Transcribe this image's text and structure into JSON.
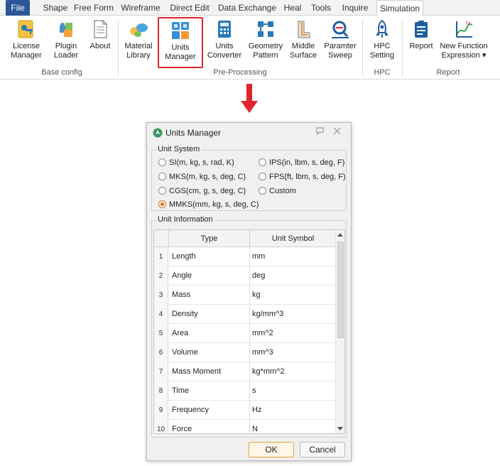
{
  "ribbon": {
    "tabs": [
      "File",
      "Shape",
      "Free Form",
      "Wireframe",
      "Direct Edit",
      "Data Exchange",
      "Heal",
      "Tools",
      "Inquire",
      "Simulation"
    ],
    "active_tab": "Simulation",
    "buttons": {
      "license_manager": [
        "License",
        "Manager"
      ],
      "plugin_loader": [
        "Plugin",
        "Loader"
      ],
      "about": [
        "About",
        ""
      ],
      "material_library": [
        "Material",
        "Library"
      ],
      "units_manager": [
        "Units",
        "Manager"
      ],
      "units_converter": [
        "Units",
        "Converter"
      ],
      "geometry_pattern": [
        "Geometry",
        "Pattern"
      ],
      "middle_surface": [
        "Middle",
        "Surface"
      ],
      "paramter_sweep": [
        "Paramter",
        "Sweep"
      ],
      "hpc_setting": [
        "HPC",
        "Setting"
      ],
      "report": [
        "Report",
        ""
      ],
      "new_function_expression": [
        "New Function",
        "Expression ▾"
      ]
    },
    "groups": [
      "Base config",
      "Pre-Processing",
      "HPC",
      "Report"
    ]
  },
  "dialog": {
    "title": "Units Manager",
    "unit_system": {
      "label": "Unit System",
      "options": [
        "SI(m, kg, s, rad, K)",
        "IPS(in, lbm, s, deg, F)",
        "MKS(m, kg, s, deg, C)",
        "FPS(ft, lbm, s, deg, F)",
        "CGS(cm, g, s, deg, C)",
        "Custom",
        "MMKS(mm, kg, s, deg, C)"
      ],
      "selected": "MMKS(mm, kg, s, deg, C)"
    },
    "unit_information": {
      "label": "Unit Information",
      "columns": [
        "Type",
        "Unit Symbol"
      ],
      "rows": [
        {
          "n": "1",
          "type": "Length",
          "unit": "mm"
        },
        {
          "n": "2",
          "type": "Angle",
          "unit": "deg"
        },
        {
          "n": "3",
          "type": "Mass",
          "unit": "kg"
        },
        {
          "n": "4",
          "type": "Density",
          "unit": "kg/mm^3"
        },
        {
          "n": "5",
          "type": "Area",
          "unit": "mm^2"
        },
        {
          "n": "6",
          "type": "Volume",
          "unit": "mm^3"
        },
        {
          "n": "7",
          "type": "Mass Moment",
          "unit": "kg*mm^2"
        },
        {
          "n": "8",
          "type": "Time",
          "unit": "s"
        },
        {
          "n": "9",
          "type": "Frequency",
          "unit": "Hz"
        },
        {
          "n": "10",
          "type": "Force",
          "unit": "N"
        }
      ]
    },
    "ok_label": "OK",
    "cancel_label": "Cancel"
  },
  "colors": {
    "file_tab": "#2b5797",
    "highlight": "#e0262b",
    "radio_selected": "#e06a1a"
  }
}
